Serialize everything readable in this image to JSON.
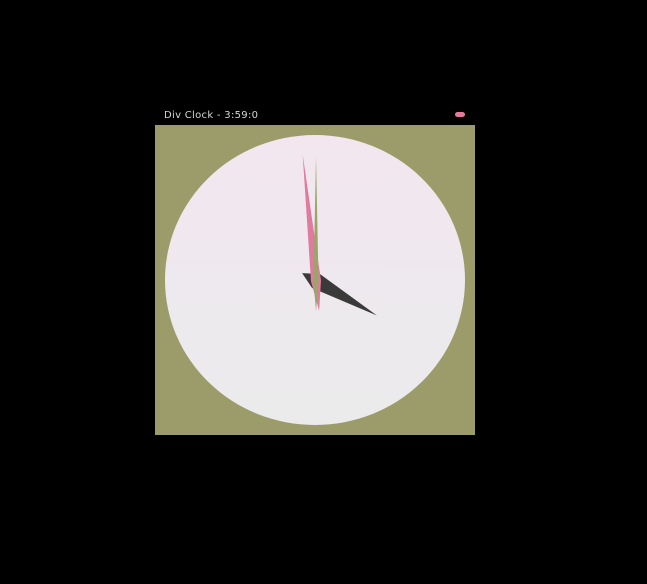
{
  "window": {
    "title": "Div Clock - 3:59:0"
  },
  "clock": {
    "hours": 3,
    "minutes": 59,
    "seconds": 0,
    "colors": {
      "background": "#9c9c6a",
      "face": "#f1e8ee",
      "hour_hand": "#3a3a3a",
      "minute_hand": "#e07a9e",
      "second_hand": "#9aa56a",
      "close_button": "#e47a9c"
    }
  }
}
